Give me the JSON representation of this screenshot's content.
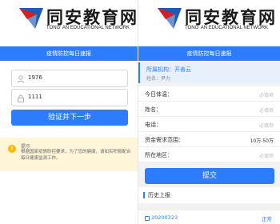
{
  "brand": {
    "name_cn": "同安教育网",
    "name_en": "TONG' AN EDUCATIONAL NETWORK"
  },
  "header": {
    "title": "疫情防控每日速报"
  },
  "login": {
    "account_value": "1976",
    "password_value": "1111",
    "submit_label": "验证并下一步"
  },
  "tip": {
    "title": "提示",
    "message": "根据国家疫情防控要求，为了您的健康，请如实积极配合每日健康监测工作。"
  },
  "report": {
    "org_line": "所属机构：开善云",
    "name_line": "姓名：尹力",
    "fields": [
      {
        "label": "今日体温：",
        "value": "必填项"
      },
      {
        "label": "姓名：",
        "value": "必填项"
      },
      {
        "label": "电话：",
        "value": "必填项"
      },
      {
        "label": "资金需求范围：",
        "value": "10万-50万"
      },
      {
        "label": "所在地区：",
        "value": "必填项"
      }
    ],
    "submit_label": "提交"
  },
  "history": {
    "title": "历史上报",
    "items": [
      {
        "date": "20200323",
        "status": "正常"
      }
    ]
  },
  "colors": {
    "accent": "#2d7cff",
    "tip_bg": "#fff6da",
    "tip_icon": "#ffb800",
    "logo_red": "#d6201f",
    "logo_blue": "#1e5bb8"
  }
}
